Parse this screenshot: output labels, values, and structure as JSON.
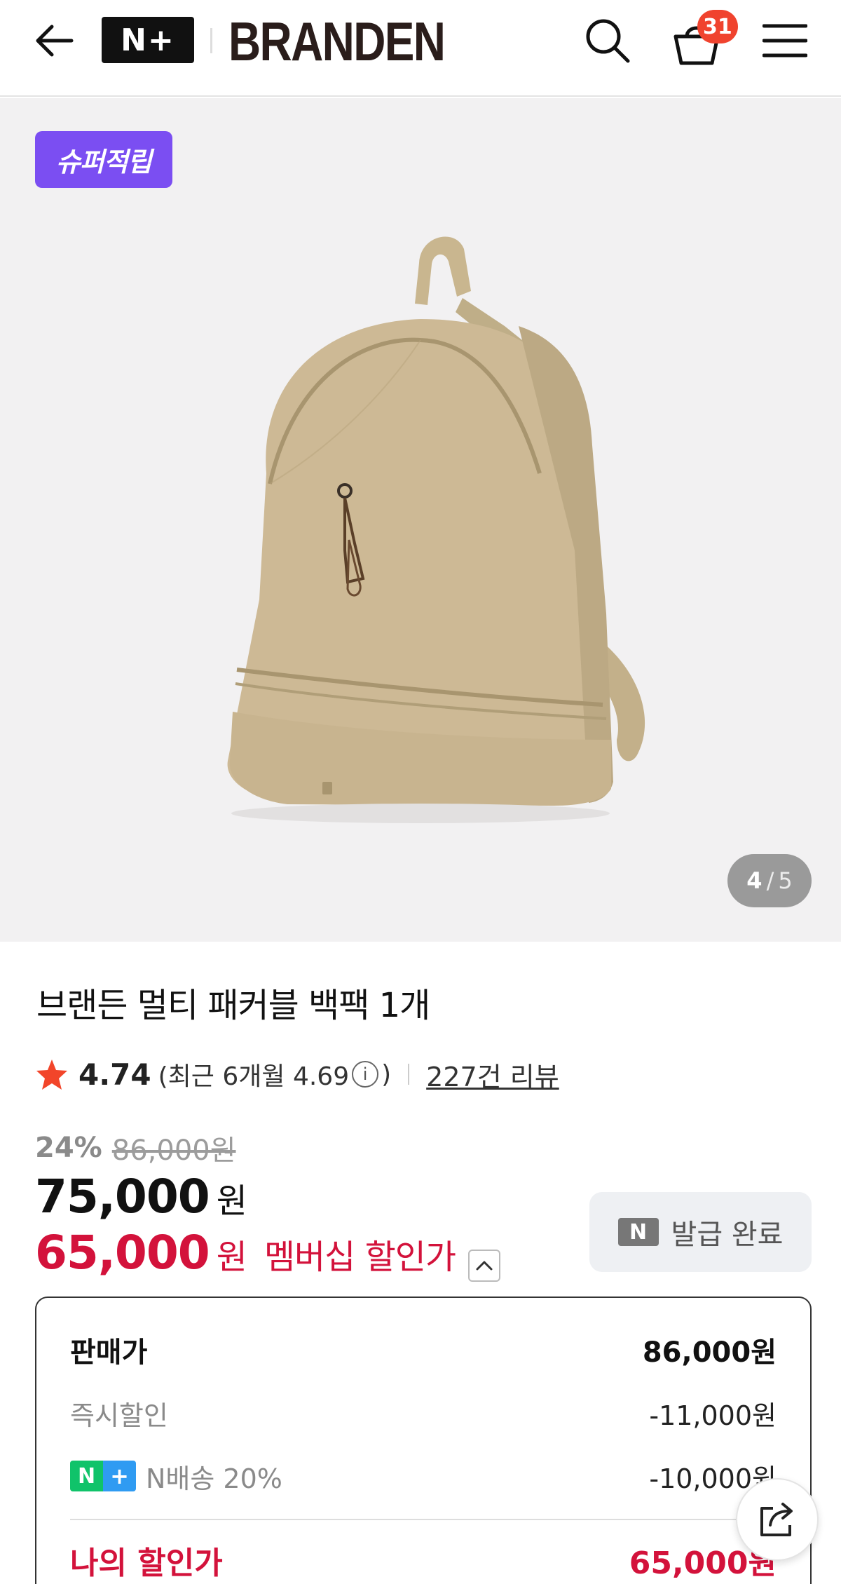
{
  "header": {
    "np_logo": "N+",
    "brand_logo": "BRANDEN",
    "cart_count": "31",
    "icons": [
      "back-arrow-icon",
      "search-icon",
      "cart-icon",
      "menu-icon"
    ]
  },
  "gallery": {
    "badge": "슈퍼적립",
    "page_current": "4",
    "page_separator": "/",
    "page_total": "5",
    "colors": {
      "background": "#f2f1f2",
      "badge": "#7b4ef2"
    }
  },
  "product": {
    "title": "브랜든 멀티 패커블 백팩 1개",
    "rating": "4.74",
    "recent_rating_text": "(최근 6개월 4.69",
    "recent_rating_close": ")",
    "review_count": "227건 리뷰",
    "discount_pct": "24%",
    "original_price": "86,000원",
    "price": "75,000",
    "price_unit": "원",
    "member_price": "65,000",
    "member_price_unit": "원",
    "member_label": "멤버십 할인가",
    "coupon_button": "발급 완료",
    "coupon_icon_text": "N"
  },
  "breakdown": {
    "sale_price_label": "판매가",
    "sale_price_value": "86,000원",
    "instant_discount_label": "즉시할인",
    "instant_discount_value": "-11,000원",
    "n_delivery_label": "N배송 20%",
    "n_delivery_value": "-10,000원",
    "n_chip_n": "N",
    "n_chip_plus": "+",
    "my_price_label": "나의 할인가",
    "my_price_value": "65,000원"
  },
  "colors": {
    "accent_red": "#d3123b",
    "badge_red": "#f0432e",
    "star": "#f2452a",
    "n_green": "#10c36a",
    "n_blue": "#2f9bf2"
  }
}
